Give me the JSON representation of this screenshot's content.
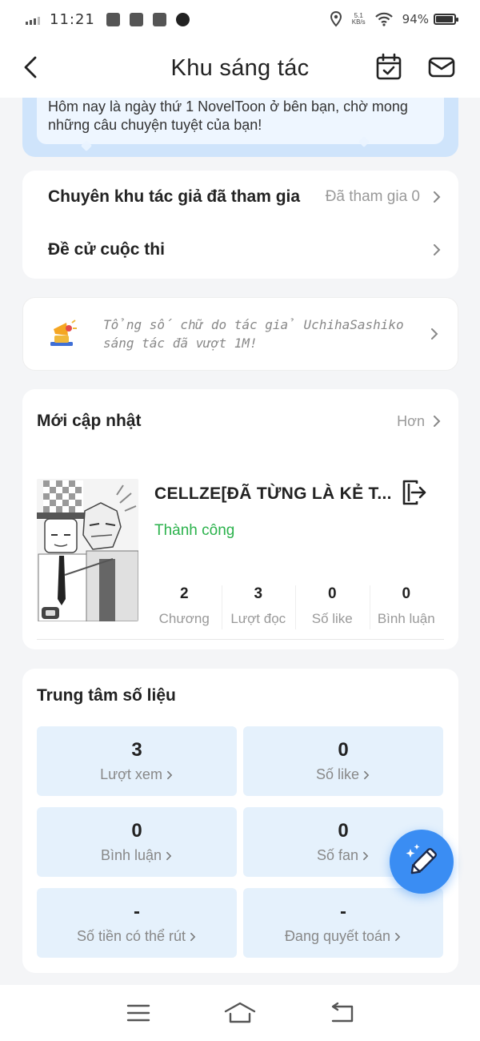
{
  "status_bar": {
    "time": "11:21",
    "net_speed_value": "5.1",
    "net_speed_unit": "KB/s",
    "battery_percent": "94%",
    "battery_level": 0.94
  },
  "header": {
    "title": "Khu sáng tác",
    "icons": [
      "back-chevron",
      "calendar-check",
      "mail"
    ]
  },
  "banner": {
    "text": "Hôm nay là ngày thứ 1 NovelToon ở bên bạn, chờ mong những câu chuyện tuyệt của bạn!"
  },
  "links": {
    "joined_label": "Chuyên khu tác giả đã tham gia",
    "joined_value": "Đã tham gia 0",
    "contest_label": "Đề cử cuộc thi"
  },
  "notice": {
    "text": "Tổng số chữ do tác giả UchihaSashiko sáng tác đã vượt 1M!",
    "icon": "megaphone"
  },
  "updates": {
    "title": "Mới cập nhật",
    "more": "Hơn",
    "book": {
      "title": "CELLZE[ĐÃ TỪNG LÀ KẺ T...",
      "status": "Thành công",
      "stats": [
        {
          "value": "2",
          "label": "Chương"
        },
        {
          "value": "3",
          "label": "Lượt đọc"
        },
        {
          "value": "0",
          "label": "Số like"
        },
        {
          "value": "0",
          "label": "Bình luận"
        }
      ]
    }
  },
  "data_center": {
    "title": "Trung tâm số liệu",
    "tiles": [
      {
        "value": "3",
        "label": "Lượt xem"
      },
      {
        "value": "0",
        "label": "Số like"
      },
      {
        "value": "0",
        "label": "Bình luận"
      },
      {
        "value": "0",
        "label": "Số fan"
      },
      {
        "value": "-",
        "label": "Số tiền có thể rút"
      },
      {
        "value": "-",
        "label": "Đang quyết toán"
      }
    ]
  },
  "colors": {
    "accent_blue": "#3a8df3",
    "success_green": "#2bb24c",
    "tile_bg": "#e5f1fc",
    "banner_bg": "#cfe4fb"
  }
}
